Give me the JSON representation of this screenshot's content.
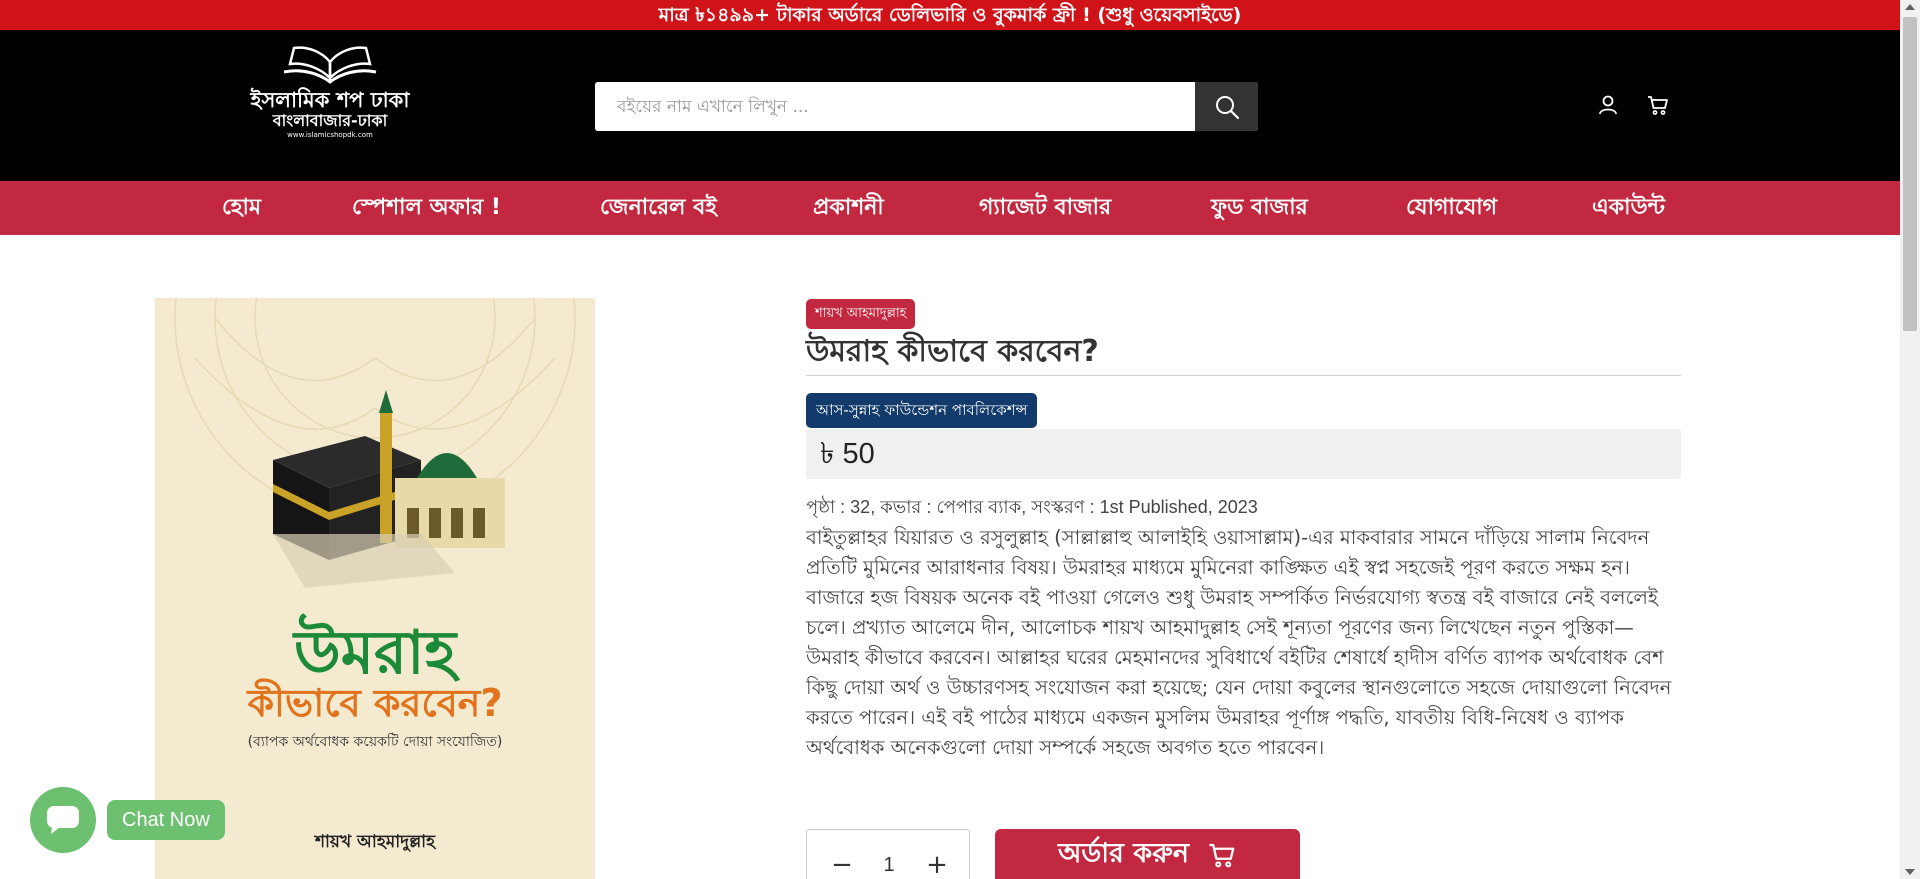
{
  "announcement": "মাত্র ৳১৪৯৯+ টাকার অর্ডারে ডেলিভারি ও বুকমার্ক ফ্রী ! (শুধু ওয়েবসাইডে)",
  "logo": {
    "name": "ইসলামিক শপ ঢাকা",
    "location": "বাংলাবাজার-ঢাকা",
    "website": "www.islamicshopdk.com"
  },
  "search": {
    "placeholder": "বইয়ের নাম এখানে লিখুন ...",
    "value": ""
  },
  "header_icons": [
    "user-icon",
    "cart-icon"
  ],
  "nav": {
    "items": [
      {
        "label": "হোম"
      },
      {
        "label": "স্পেশাল অফার !"
      },
      {
        "label": "জেনারেল বই"
      },
      {
        "label": "প্রকাশনী"
      },
      {
        "label": "গ্যাজেট বাজার"
      },
      {
        "label": "ফুড বাজার"
      },
      {
        "label": "যোগাযোগ"
      },
      {
        "label": "একাউন্ট"
      }
    ]
  },
  "cover": {
    "title_line1": "উমরাহ",
    "title_line2": "কীভাবে করবেন?",
    "subtitle": "(ব্যাপক অর্থবোধক কয়েকটি দোয়া সংযোজিত)",
    "author": "শায়খ আহমাদুল্লাহ"
  },
  "product": {
    "author": "শায়খ আহমাদুল্লাহ",
    "title": "উমরাহ কীভাবে করবেন?",
    "publisher": "আস-সুন্নাহ ফাউন্ডেশন পাবলিকেশন্স",
    "price": "৳ 50",
    "meta": "পৃষ্ঠা : 32, কভার : পেপার ব্যাক, সংস্করণ : 1st Published, 2023",
    "description": "বাইতুল্লাহর যিয়ারত ও রসুলুল্লাহ (সাল্লাল্লাহু আলাইহি ওয়াসাল্লাম)-এর মাকবারার সামনে দাঁড়িয়ে সালাম নিবেদন প্রতিটি মুমিনের আরাধনার বিষয়। উমরাহর মাধ্যমে মুমিনেরা কাঙ্ক্ষিত এই স্বপ্ন সহজেই পূরণ করতে সক্ষম হন। বাজারে হজ বিষয়ক অনেক বই পাওয়া গেলেও শুধু উমরাহ সম্পর্কিত নির্ভরযোগ্য স্বতন্ত্র বই বাজারে নেই বললেই চলে। প্রখ্যাত আলেমে দীন, আলোচক শায়খ আহমাদুল্লাহ সেই শূন্যতা পূরণের জন্য লিখেছেন নতুন পুস্তিকা—উমরাহ কীভাবে করবেন। আল্লাহর ঘরের মেহমানদের সুবিধার্থে বইটির শেষার্ধে হাদীস বর্ণিত ব্যাপক অর্থবোধক বেশ কিছু দোয়া অর্থ ও উচ্চারণসহ সংযোজন করা হয়েছে; যেন দোয়া কবুলের স্থানগুলোতে সহজে দোয়াগুলো নিবেদন করতে পারেন। এই বই পাঠের মাধ্যমে একজন মুসলিম উমরাহর পূর্ণাঙ্গ পদ্ধতি, যাবতীয় বিধি-নিষেধ ও ব্যাপক অর্থবোধক অনেকগুলো দোয়া সম্পর্কে সহজে অবগত হতে পারবেন।",
    "quantity": "1",
    "order_label": "অর্ডার করুন"
  },
  "chat": {
    "label": "Chat Now"
  },
  "colors": {
    "announcement": "#d01219",
    "header": "#000000",
    "nav": "#c2283f",
    "publisher_badge": "#123a6b",
    "chat": "#6cc06f"
  }
}
